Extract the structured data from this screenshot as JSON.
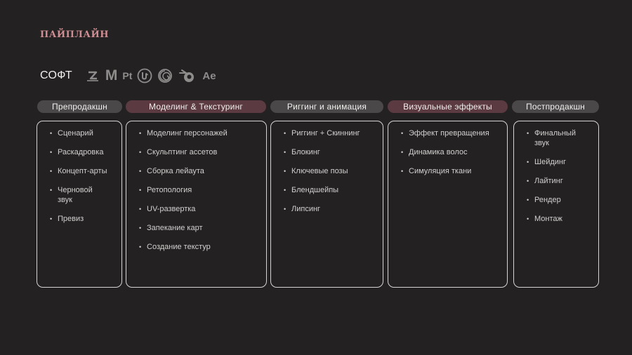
{
  "logo": "ПАЙПЛАЙН",
  "soft": {
    "title": "СОФТ",
    "icons": [
      {
        "name": "zbrush-icon"
      },
      {
        "name": "maya-icon",
        "label": "M"
      },
      {
        "name": "substance-painter-icon",
        "label": "Pt"
      },
      {
        "name": "unreal-engine-icon"
      },
      {
        "name": "houdini-icon"
      },
      {
        "name": "blender-icon"
      },
      {
        "name": "after-effects-icon",
        "label": "Ae"
      }
    ]
  },
  "stages": [
    {
      "title": "Препродакшн",
      "items": [
        "Сценарий",
        "Раскадровка",
        "Концепт-арты",
        "Черновой звук",
        "Превиз"
      ]
    },
    {
      "title": "Моделинг & Текстуринг",
      "items": [
        "Моделинг персонажей",
        "Скульптинг ассетов",
        "Сборка лейаута",
        "Ретопология",
        "UV-развертка",
        "Запекание карт",
        "Создание текстур"
      ]
    },
    {
      "title": "Риггинг и анимация",
      "items": [
        "Риггинг + Скиннинг",
        "Блокинг",
        "Ключевые позы",
        "Блендшейпы",
        "Липсинг"
      ]
    },
    {
      "title": "Визуальные эффекты",
      "items": [
        "Эффект превращения",
        "Динамика волос",
        "Симуляция ткани"
      ]
    },
    {
      "title": "Постпродакшн",
      "items": [
        "Финальный звук",
        "Шейдинг",
        "Лайтинг",
        "Рендер",
        "Монтаж"
      ]
    }
  ],
  "colors": {
    "background": "#232121",
    "accent": "#cf8e93",
    "pill": "#4a4848",
    "pill_highlight": "#5b3b41",
    "card_border": "#d6d3d3"
  }
}
